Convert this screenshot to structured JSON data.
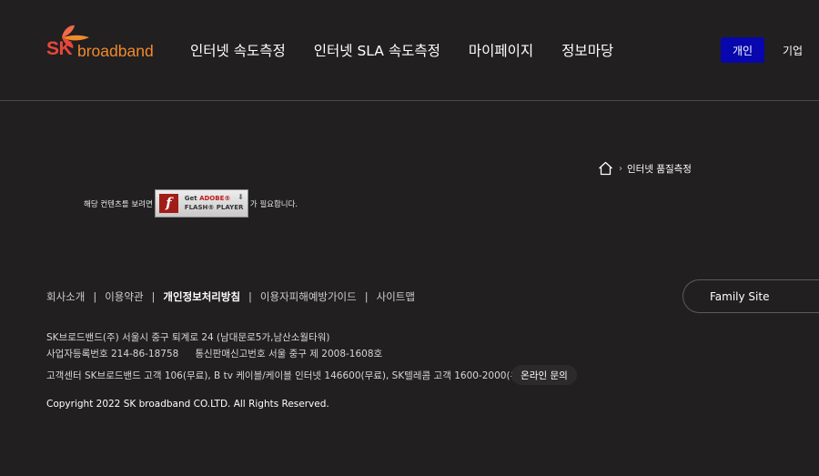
{
  "brand": {
    "logo_sk": "SK",
    "logo_broadband": "broadband",
    "colors": {
      "sk": "#e8473a",
      "broadband": "#f08a2c",
      "butterfly": "#f06a4a"
    }
  },
  "gnb": {
    "items": [
      {
        "label": "인터넷 속도측정"
      },
      {
        "label": "인터넷 SLA 속도측정"
      },
      {
        "label": "마이페이지"
      },
      {
        "label": "정보마당"
      }
    ]
  },
  "segment": {
    "personal": "개인",
    "business": "기업",
    "active_color": "#0707ad"
  },
  "breadcrumb": {
    "home_icon": "home-icon",
    "current": "인터넷 품질측정"
  },
  "flash_notice": {
    "before": "해당 컨텐츠를 보려면",
    "after": "가 필요합니다.",
    "badge": {
      "f_glyph": "f",
      "get": "Get",
      "adobe": "ADOBE®",
      "player": "FLASH® PLAYER"
    }
  },
  "footer": {
    "links": [
      {
        "label": "회사소개",
        "bold": false
      },
      {
        "label": "이용약관",
        "bold": false
      },
      {
        "label": "개인정보처리방침",
        "bold": true
      },
      {
        "label": "이용자피해예방가이드",
        "bold": false
      },
      {
        "label": "사이트맵",
        "bold": false
      }
    ],
    "family_site": "Family Site",
    "address": "SK브로드밴드(주) 서울시 중구 퇴계로 24 (남대문로5가,남산소월타워)",
    "biz_reg": "사업자등록번호 214-86-18758",
    "telecom_reg": "통신판매신고번호 서울 중구 제 2008-1608호",
    "customer_center": "고객센터 SK브로드밴드 고객 106(무료), B tv 케이블/케이블 인터넷 146600(무료), SK텔레콤 고객 1600-2000(유료)",
    "online_inquiry": "온라인 문의",
    "copyright": "Copyright 2022 SK broadband CO.LTD. All Rights Reserved."
  }
}
